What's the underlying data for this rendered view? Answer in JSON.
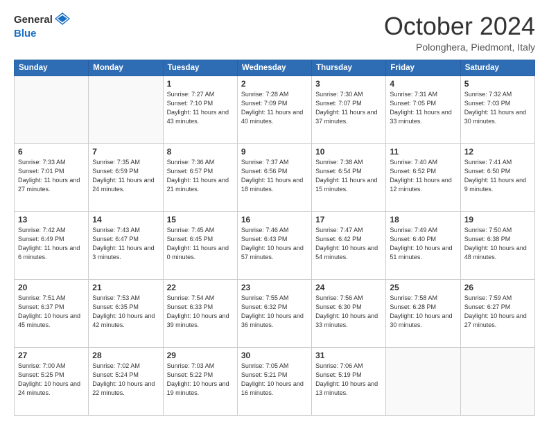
{
  "header": {
    "logo_general": "General",
    "logo_blue": "Blue",
    "month_title": "October 2024",
    "location": "Polonghera, Piedmont, Italy"
  },
  "weekdays": [
    "Sunday",
    "Monday",
    "Tuesday",
    "Wednesday",
    "Thursday",
    "Friday",
    "Saturday"
  ],
  "weeks": [
    [
      {
        "day": "",
        "sunrise": "",
        "sunset": "",
        "daylight": ""
      },
      {
        "day": "",
        "sunrise": "",
        "sunset": "",
        "daylight": ""
      },
      {
        "day": "1",
        "sunrise": "Sunrise: 7:27 AM",
        "sunset": "Sunset: 7:10 PM",
        "daylight": "Daylight: 11 hours and 43 minutes."
      },
      {
        "day": "2",
        "sunrise": "Sunrise: 7:28 AM",
        "sunset": "Sunset: 7:09 PM",
        "daylight": "Daylight: 11 hours and 40 minutes."
      },
      {
        "day": "3",
        "sunrise": "Sunrise: 7:30 AM",
        "sunset": "Sunset: 7:07 PM",
        "daylight": "Daylight: 11 hours and 37 minutes."
      },
      {
        "day": "4",
        "sunrise": "Sunrise: 7:31 AM",
        "sunset": "Sunset: 7:05 PM",
        "daylight": "Daylight: 11 hours and 33 minutes."
      },
      {
        "day": "5",
        "sunrise": "Sunrise: 7:32 AM",
        "sunset": "Sunset: 7:03 PM",
        "daylight": "Daylight: 11 hours and 30 minutes."
      }
    ],
    [
      {
        "day": "6",
        "sunrise": "Sunrise: 7:33 AM",
        "sunset": "Sunset: 7:01 PM",
        "daylight": "Daylight: 11 hours and 27 minutes."
      },
      {
        "day": "7",
        "sunrise": "Sunrise: 7:35 AM",
        "sunset": "Sunset: 6:59 PM",
        "daylight": "Daylight: 11 hours and 24 minutes."
      },
      {
        "day": "8",
        "sunrise": "Sunrise: 7:36 AM",
        "sunset": "Sunset: 6:57 PM",
        "daylight": "Daylight: 11 hours and 21 minutes."
      },
      {
        "day": "9",
        "sunrise": "Sunrise: 7:37 AM",
        "sunset": "Sunset: 6:56 PM",
        "daylight": "Daylight: 11 hours and 18 minutes."
      },
      {
        "day": "10",
        "sunrise": "Sunrise: 7:38 AM",
        "sunset": "Sunset: 6:54 PM",
        "daylight": "Daylight: 11 hours and 15 minutes."
      },
      {
        "day": "11",
        "sunrise": "Sunrise: 7:40 AM",
        "sunset": "Sunset: 6:52 PM",
        "daylight": "Daylight: 11 hours and 12 minutes."
      },
      {
        "day": "12",
        "sunrise": "Sunrise: 7:41 AM",
        "sunset": "Sunset: 6:50 PM",
        "daylight": "Daylight: 11 hours and 9 minutes."
      }
    ],
    [
      {
        "day": "13",
        "sunrise": "Sunrise: 7:42 AM",
        "sunset": "Sunset: 6:49 PM",
        "daylight": "Daylight: 11 hours and 6 minutes."
      },
      {
        "day": "14",
        "sunrise": "Sunrise: 7:43 AM",
        "sunset": "Sunset: 6:47 PM",
        "daylight": "Daylight: 11 hours and 3 minutes."
      },
      {
        "day": "15",
        "sunrise": "Sunrise: 7:45 AM",
        "sunset": "Sunset: 6:45 PM",
        "daylight": "Daylight: 11 hours and 0 minutes."
      },
      {
        "day": "16",
        "sunrise": "Sunrise: 7:46 AM",
        "sunset": "Sunset: 6:43 PM",
        "daylight": "Daylight: 10 hours and 57 minutes."
      },
      {
        "day": "17",
        "sunrise": "Sunrise: 7:47 AM",
        "sunset": "Sunset: 6:42 PM",
        "daylight": "Daylight: 10 hours and 54 minutes."
      },
      {
        "day": "18",
        "sunrise": "Sunrise: 7:49 AM",
        "sunset": "Sunset: 6:40 PM",
        "daylight": "Daylight: 10 hours and 51 minutes."
      },
      {
        "day": "19",
        "sunrise": "Sunrise: 7:50 AM",
        "sunset": "Sunset: 6:38 PM",
        "daylight": "Daylight: 10 hours and 48 minutes."
      }
    ],
    [
      {
        "day": "20",
        "sunrise": "Sunrise: 7:51 AM",
        "sunset": "Sunset: 6:37 PM",
        "daylight": "Daylight: 10 hours and 45 minutes."
      },
      {
        "day": "21",
        "sunrise": "Sunrise: 7:53 AM",
        "sunset": "Sunset: 6:35 PM",
        "daylight": "Daylight: 10 hours and 42 minutes."
      },
      {
        "day": "22",
        "sunrise": "Sunrise: 7:54 AM",
        "sunset": "Sunset: 6:33 PM",
        "daylight": "Daylight: 10 hours and 39 minutes."
      },
      {
        "day": "23",
        "sunrise": "Sunrise: 7:55 AM",
        "sunset": "Sunset: 6:32 PM",
        "daylight": "Daylight: 10 hours and 36 minutes."
      },
      {
        "day": "24",
        "sunrise": "Sunrise: 7:56 AM",
        "sunset": "Sunset: 6:30 PM",
        "daylight": "Daylight: 10 hours and 33 minutes."
      },
      {
        "day": "25",
        "sunrise": "Sunrise: 7:58 AM",
        "sunset": "Sunset: 6:28 PM",
        "daylight": "Daylight: 10 hours and 30 minutes."
      },
      {
        "day": "26",
        "sunrise": "Sunrise: 7:59 AM",
        "sunset": "Sunset: 6:27 PM",
        "daylight": "Daylight: 10 hours and 27 minutes."
      }
    ],
    [
      {
        "day": "27",
        "sunrise": "Sunrise: 7:00 AM",
        "sunset": "Sunset: 5:25 PM",
        "daylight": "Daylight: 10 hours and 24 minutes."
      },
      {
        "day": "28",
        "sunrise": "Sunrise: 7:02 AM",
        "sunset": "Sunset: 5:24 PM",
        "daylight": "Daylight: 10 hours and 22 minutes."
      },
      {
        "day": "29",
        "sunrise": "Sunrise: 7:03 AM",
        "sunset": "Sunset: 5:22 PM",
        "daylight": "Daylight: 10 hours and 19 minutes."
      },
      {
        "day": "30",
        "sunrise": "Sunrise: 7:05 AM",
        "sunset": "Sunset: 5:21 PM",
        "daylight": "Daylight: 10 hours and 16 minutes."
      },
      {
        "day": "31",
        "sunrise": "Sunrise: 7:06 AM",
        "sunset": "Sunset: 5:19 PM",
        "daylight": "Daylight: 10 hours and 13 minutes."
      },
      {
        "day": "",
        "sunrise": "",
        "sunset": "",
        "daylight": ""
      },
      {
        "day": "",
        "sunrise": "",
        "sunset": "",
        "daylight": ""
      }
    ]
  ]
}
